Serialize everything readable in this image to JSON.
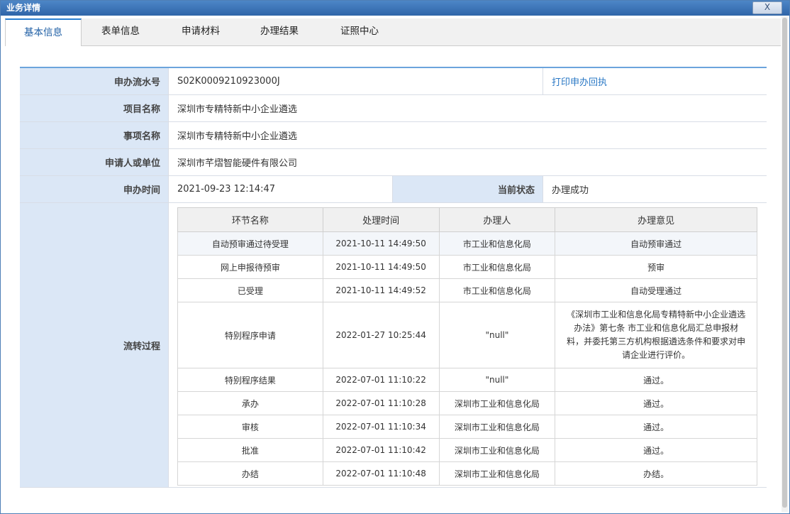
{
  "window": {
    "title": "业务详情",
    "close_label": "X"
  },
  "tabs": [
    {
      "label": "基本信息",
      "active": true
    },
    {
      "label": "表单信息",
      "active": false
    },
    {
      "label": "申请材料",
      "active": false
    },
    {
      "label": "办理结果",
      "active": false
    },
    {
      "label": "证照中心",
      "active": false
    }
  ],
  "info": {
    "serial_label": "申办流水号",
    "serial_value": "S02K0009210923000J",
    "print_link": "打印申办回执",
    "project_label": "项目名称",
    "project_value": "深圳市专精特新中小企业遴选",
    "item_label": "事项名称",
    "item_value": "深圳市专精特新中小企业遴选",
    "applicant_label": "申请人或单位",
    "applicant_value": "深圳市芊熠智能硬件有限公司",
    "time_label": "申办时间",
    "time_value": "2021-09-23 12:14:47",
    "status_label": "当前状态",
    "status_value": "办理成功",
    "flow_label": "流转过程"
  },
  "process": {
    "headers": [
      "环节名称",
      "处理时间",
      "办理人",
      "办理意见"
    ],
    "rows": [
      [
        "自动预审通过待受理",
        "2021-10-11 14:49:50",
        "市工业和信息化局",
        "自动预审通过"
      ],
      [
        "网上申报待预审",
        "2021-10-11 14:49:50",
        "市工业和信息化局",
        "预审"
      ],
      [
        "已受理",
        "2021-10-11 14:49:52",
        "市工业和信息化局",
        "自动受理通过"
      ],
      [
        "特别程序申请",
        "2022-01-27 10:25:44",
        "\"null\"",
        "《深圳市工业和信息化局专精特新中小企业遴选办法》第七条 市工业和信息化局汇总申报材料，并委托第三方机构根据遴选条件和要求对申请企业进行评价。"
      ],
      [
        "特别程序结果",
        "2022-07-01 11:10:22",
        "\"null\"",
        "通过。"
      ],
      [
        "承办",
        "2022-07-01 11:10:28",
        "深圳市工业和信息化局",
        "通过。"
      ],
      [
        "审核",
        "2022-07-01 11:10:34",
        "深圳市工业和信息化局",
        "通过。"
      ],
      [
        "批准",
        "2022-07-01 11:10:42",
        "深圳市工业和信息化局",
        "通过。"
      ],
      [
        "办结",
        "2022-07-01 11:10:48",
        "深圳市工业和信息化局",
        "办结。"
      ]
    ]
  }
}
